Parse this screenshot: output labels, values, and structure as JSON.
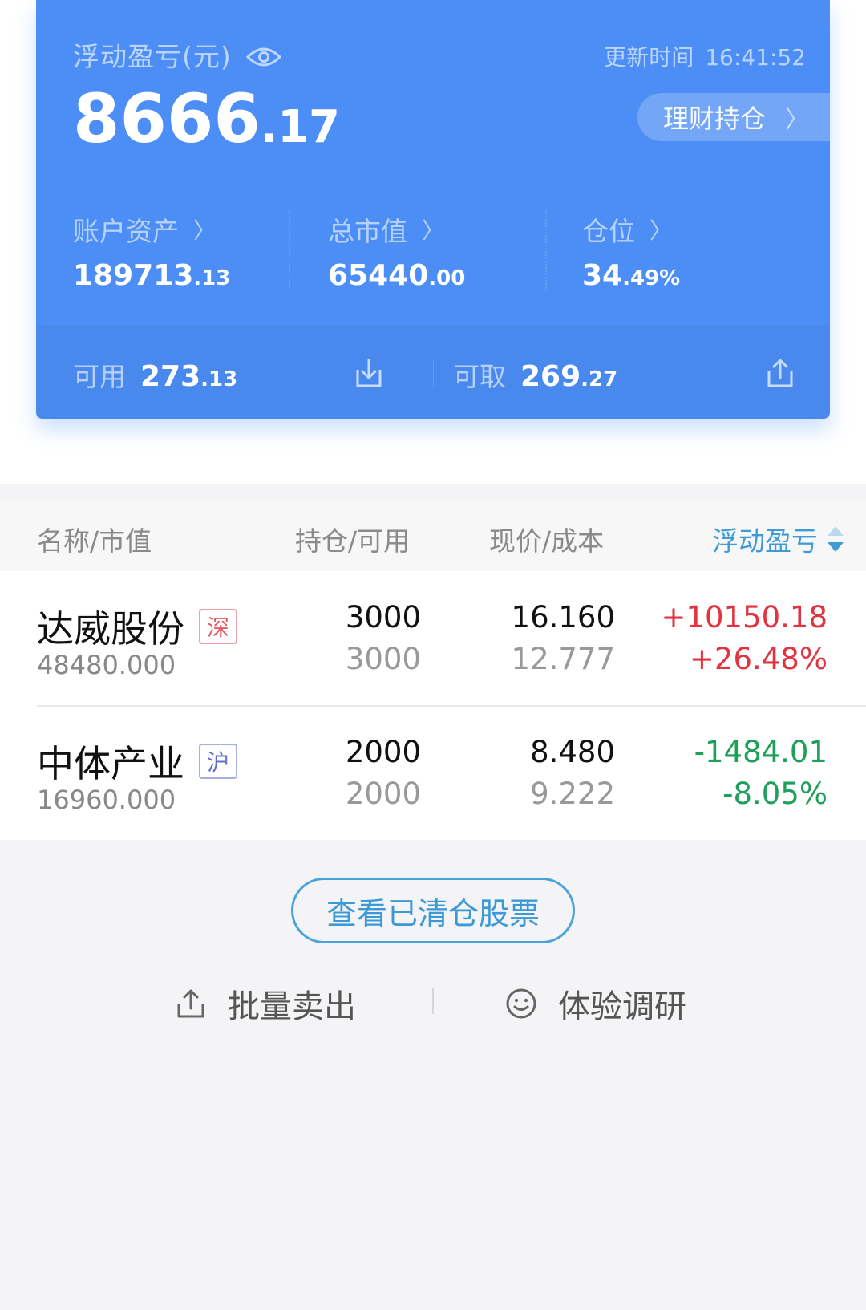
{
  "summary": {
    "floating_pl_label": "浮动盈亏(元)",
    "update_label": "更新时间",
    "update_time": "16:41:52",
    "floating_pl_int": "8666",
    "floating_pl_dec": ".17",
    "wealth_button": "理财持仓",
    "account_assets_label": "账户资产",
    "account_assets_int": "189713",
    "account_assets_dec": ".13",
    "market_value_label": "总市值",
    "market_value_int": "65440",
    "market_value_dec": ".00",
    "position_label": "仓位",
    "position_int": "34",
    "position_dec": ".49%",
    "available_label": "可用",
    "available_int": "273",
    "available_dec": ".13",
    "withdrawable_label": "可取",
    "withdrawable_int": "269",
    "withdrawable_dec": ".27"
  },
  "table": {
    "headers": [
      "名称/市值",
      "持仓/可用",
      "现价/成本",
      "浮动盈亏"
    ],
    "rows": [
      {
        "name": "达威股份",
        "market": "深",
        "market_value": "48480.000",
        "holding": "3000",
        "available": "3000",
        "price": "16.160",
        "cost": "12.777",
        "pl": "+10150.18",
        "pl_pct": "+26.48%"
      },
      {
        "name": "中体产业",
        "market": "沪",
        "market_value": "16960.000",
        "holding": "2000",
        "available": "2000",
        "price": "8.480",
        "cost": "9.222",
        "pl": "-1484.01",
        "pl_pct": "-8.05%"
      }
    ]
  },
  "actions": {
    "cleared_stocks": "查看已清仓股票",
    "batch_sell": "批量卖出",
    "survey": "体验调研"
  },
  "colors": {
    "card_blue": "#4c8ef5",
    "gain_red": "#e2333f",
    "loss_green": "#1ea05a",
    "accent_blue": "#3b99d8",
    "sz_tag": "#e05b63",
    "sh_tag": "#6670c7"
  },
  "icons": {
    "eye": "eye-icon",
    "chevron": "chevron-right-icon",
    "transfer_in": "transfer-in-icon",
    "transfer_out": "transfer-out-icon",
    "sort": "sort-icon",
    "batch_sell": "upload-icon",
    "survey": "smiley-icon"
  }
}
